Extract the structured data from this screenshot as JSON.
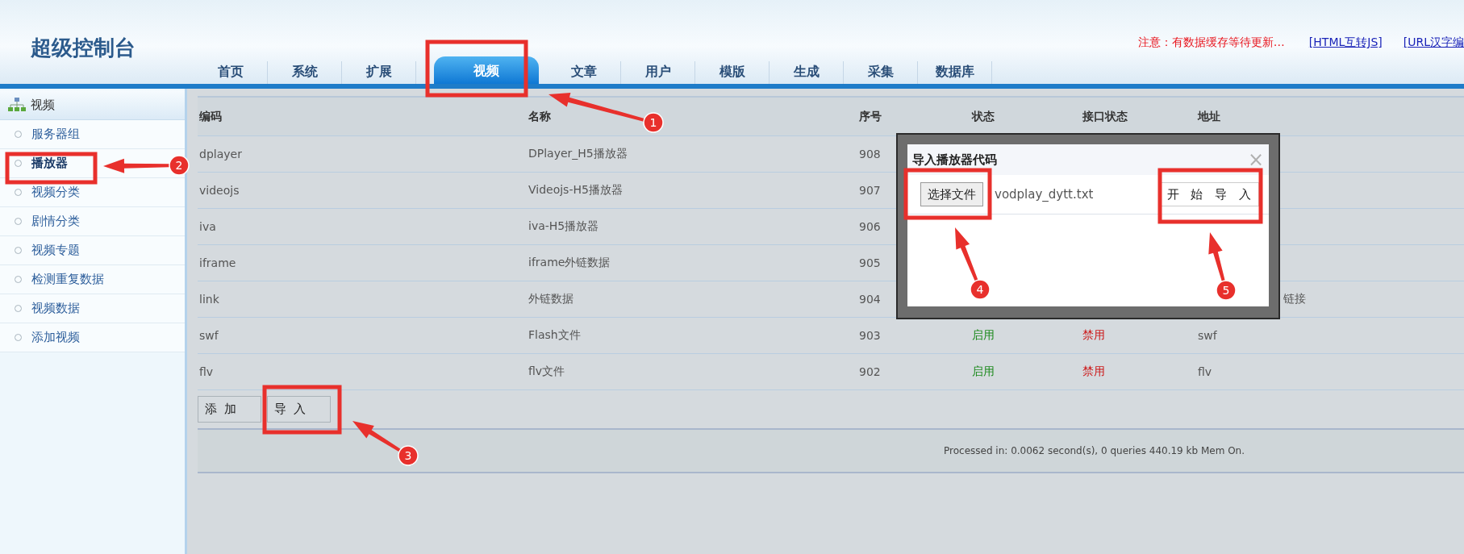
{
  "header": {
    "title": "超级控制台",
    "notice": "注意：有数据缓存等待更新…",
    "links": [
      "[HTML互转JS]",
      "[URL汉字编"
    ]
  },
  "tabs": [
    {
      "label": "首页",
      "selected": false
    },
    {
      "label": "系统",
      "selected": false
    },
    {
      "label": "扩展",
      "selected": false
    },
    {
      "label": "视频",
      "selected": true
    },
    {
      "label": "文章",
      "selected": false
    },
    {
      "label": "用户",
      "selected": false
    },
    {
      "label": "模版",
      "selected": false
    },
    {
      "label": "生成",
      "selected": false
    },
    {
      "label": "采集",
      "selected": false
    },
    {
      "label": "数据库",
      "selected": false
    }
  ],
  "sidebar": {
    "title": "视频",
    "items": [
      {
        "label": "服务器组",
        "selected": false
      },
      {
        "label": "播放器",
        "selected": true
      },
      {
        "label": "视频分类",
        "selected": false
      },
      {
        "label": "剧情分类",
        "selected": false
      },
      {
        "label": "视频专题",
        "selected": false
      },
      {
        "label": "检测重复数据",
        "selected": false
      },
      {
        "label": "视频数据",
        "selected": false
      },
      {
        "label": "添加视频",
        "selected": false
      }
    ]
  },
  "table": {
    "columns": [
      "编码",
      "名称",
      "序号",
      "状态",
      "接口状态",
      "地址"
    ],
    "rows": [
      {
        "code": "dplayer",
        "name": "DPlayer_H5播放器",
        "order": "908"
      },
      {
        "code": "videojs",
        "name": "Videojs-H5播放器",
        "order": "907"
      },
      {
        "code": "iva",
        "name": "iva-H5播放器",
        "order": "906"
      },
      {
        "code": "iframe",
        "name": "iframe外链数据",
        "order": "905"
      },
      {
        "code": "link",
        "name": "外链数据",
        "order": "904",
        "address": "链接"
      },
      {
        "code": "swf",
        "name": "Flash文件",
        "order": "903",
        "status": {
          "text": "启用",
          "enabled": true
        },
        "api_status": {
          "text": "禁用",
          "enabled": false
        },
        "address": "swf"
      },
      {
        "code": "flv",
        "name": "flv文件",
        "order": "902",
        "status": {
          "text": "启用",
          "enabled": true
        },
        "api_status": {
          "text": "禁用",
          "enabled": false
        },
        "address": "flv"
      }
    ]
  },
  "buttons": [
    "添 加",
    "导 入"
  ],
  "footer": "Processed in: 0.0062 second(s), 0 queries 440.19 kb Mem On.",
  "dialog": {
    "title": "导入播放器代码",
    "close": "×",
    "file_button": "选择文件",
    "file_name": "vodplay_dytt.txt",
    "start_button": "开 始 导 入"
  },
  "annotations": [
    {
      "label": "1"
    },
    {
      "label": "2"
    },
    {
      "label": "3"
    },
    {
      "label": "4"
    },
    {
      "label": "5"
    }
  ]
}
